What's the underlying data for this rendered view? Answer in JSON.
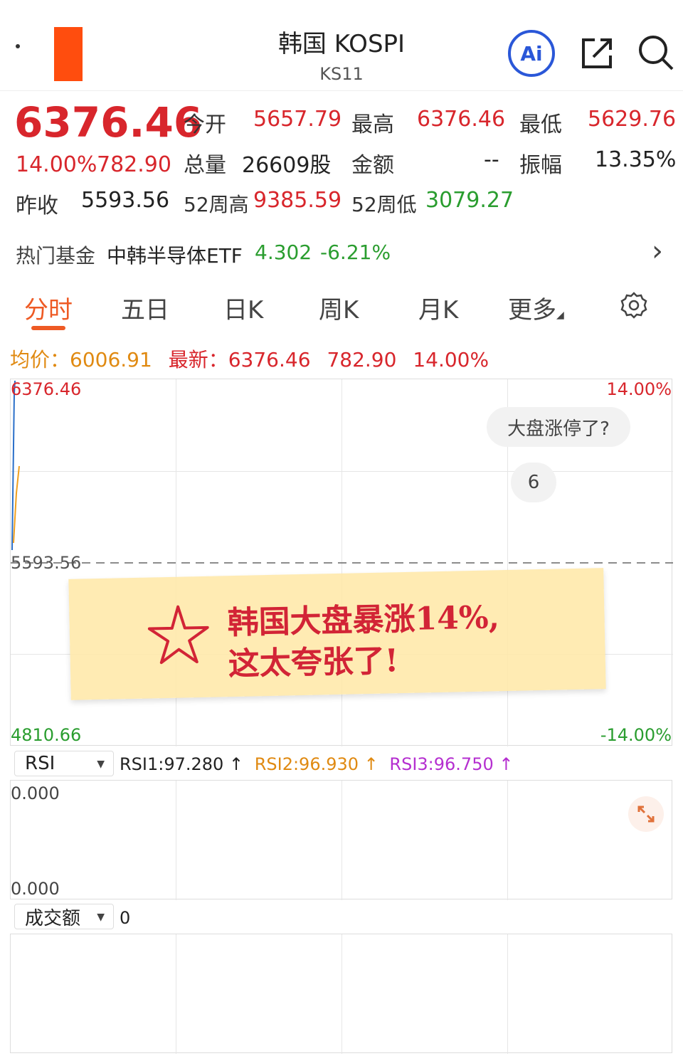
{
  "header": {
    "title": "韩国 KOSPI",
    "subtitle": "KS11",
    "ai_label": "Ai"
  },
  "quote": {
    "price": "6376.46",
    "change_pct": "14.00%",
    "change_abs": "782.90",
    "prev_close_label": "昨收",
    "prev_close": "5593.56",
    "open_label": "今开",
    "open": "5657.79",
    "high_label": "最高",
    "high": "6376.46",
    "low_label": "最低",
    "low": "5629.76",
    "volume_label": "总量",
    "volume": "26609股",
    "amount_label": "金额",
    "amount": "--",
    "amplitude_label": "振幅",
    "amplitude": "13.35%",
    "week52_high_label": "52周高",
    "week52_high": "9385.59",
    "week52_low_label": "52周低",
    "week52_low": "3079.27"
  },
  "fund": {
    "label": "热门基金",
    "name": "中韩半导体ETF",
    "price": "4.302",
    "change": "-6.21%",
    "arrow": "›"
  },
  "tabs": [
    "分时",
    "五日",
    "日K",
    "周K",
    "月K",
    "更多"
  ],
  "info": {
    "avg_label": "均价：",
    "avg": "6006.91",
    "latest_label": "最新：",
    "latest": "6376.46",
    "change": "782.90",
    "change_pct": "14.00%"
  },
  "chart": {
    "y_top": "6376.46",
    "y_mid": "5593.56",
    "y_bottom": "4810.66",
    "pct_top": "14.00%",
    "pct_bottom": "-14.00%",
    "bubble_question": "大盘涨停了?",
    "bubble_count": "6",
    "colors": {
      "price_line": "#2a6fc9",
      "avg_line": "#f0a020",
      "up": "#d8262c",
      "down": "#2a9d2f"
    }
  },
  "note": {
    "line1": "韩国大盘暴涨14%,",
    "line2": "这太夸张了!"
  },
  "rsi": {
    "selector": "RSI",
    "rsi1": "RSI1:97.280 ↑",
    "rsi2": "RSI2:96.930 ↑",
    "rsi3": "RSI3:96.750 ↑",
    "y_top": "0.000",
    "y_bottom": "0.000"
  },
  "volume_panel": {
    "selector": "成交额",
    "value": "0"
  },
  "chart_data": {
    "type": "line",
    "series": [],
    "ylim": [
      4810.66,
      6376.46
    ]
  }
}
